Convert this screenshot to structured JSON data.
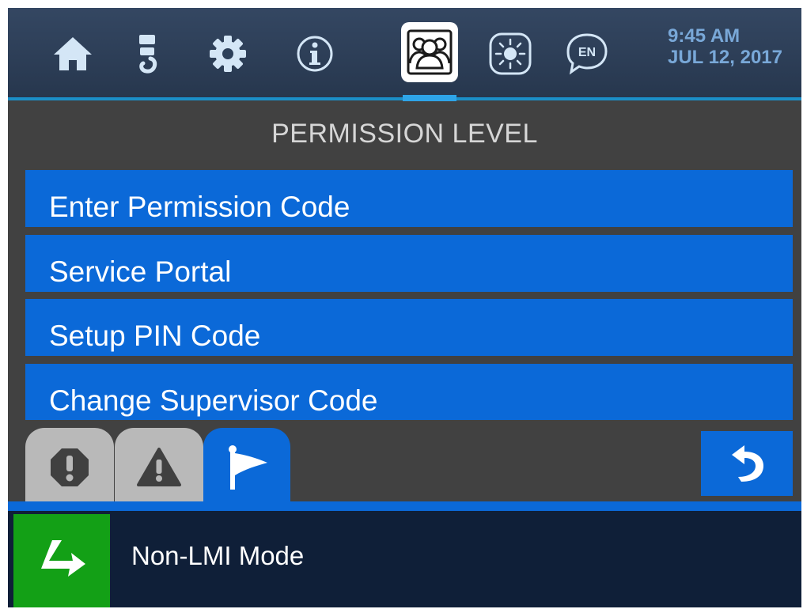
{
  "nav": {
    "icons": [
      "home-icon",
      "crane-hook-icon",
      "settings-gear-icon",
      "info-icon",
      "users-icon",
      "brightness-icon",
      "language-icon"
    ],
    "language_badge": "EN",
    "active": "users-icon"
  },
  "clock": {
    "time": "9:45 AM",
    "date": "JUL 12, 2017"
  },
  "page": {
    "title": "PERMISSION LEVEL"
  },
  "menu": {
    "items": [
      {
        "label": "Enter Permission Code"
      },
      {
        "label": "Service Portal"
      },
      {
        "label": "Setup PIN Code"
      },
      {
        "label": "Change Supervisor Code"
      }
    ]
  },
  "tabs": {
    "items": [
      "critical-alert-icon",
      "warning-icon",
      "flag-icon"
    ],
    "active": "flag-icon"
  },
  "status": {
    "mode_label": "Non-LMI Mode"
  },
  "colors": {
    "topbar": "#2f425d",
    "accent_line": "#1b8fc8",
    "menu_blue": "#0b69d8",
    "background": "#414141",
    "statusbar": "#0f1f38",
    "mode_green": "#13a016",
    "clock_text": "#79a8d8"
  }
}
